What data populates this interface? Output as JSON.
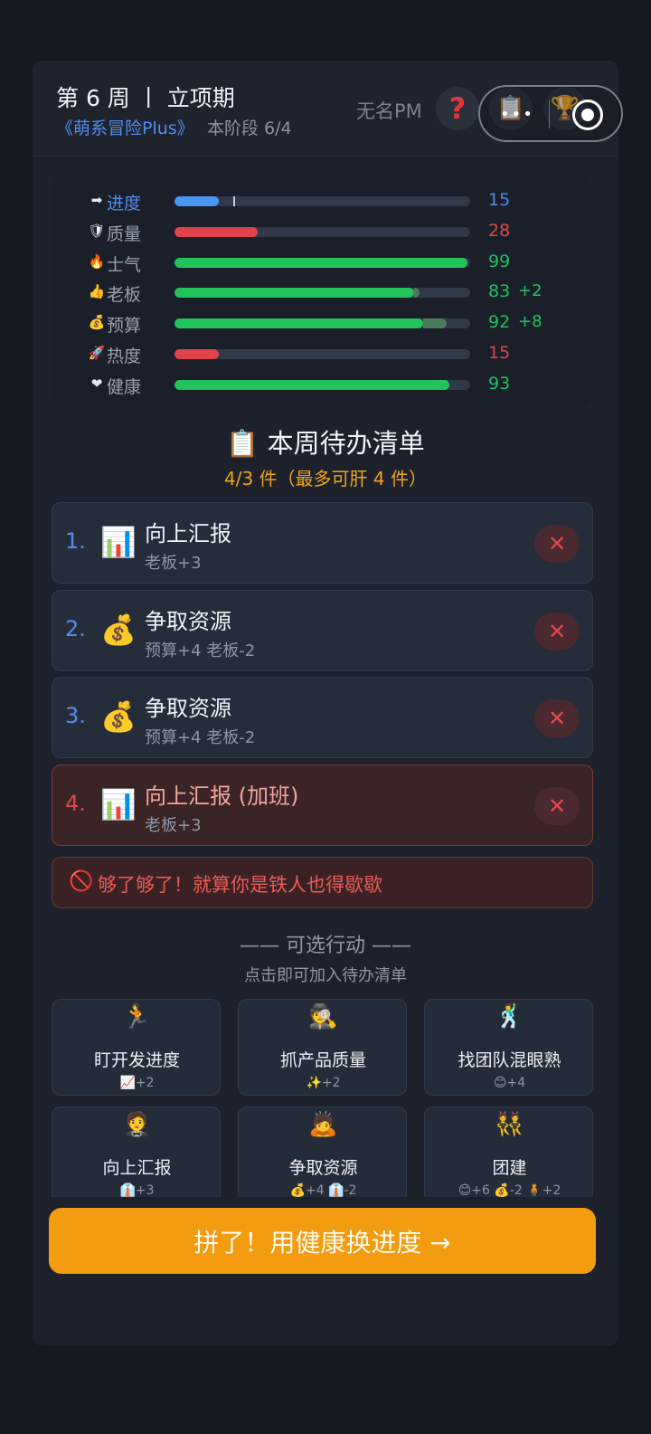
{
  "header": {
    "week_title": "第 6 周 丨 立项期",
    "game_name": "《萌系冒险Plus》",
    "stage": "本阶段 6/4",
    "player_name": "无名PM",
    "help_icon": "?",
    "log_icon": "📋",
    "trophy_icon": "🏆",
    "capsule_dots": "•••"
  },
  "stats": [
    {
      "icon": "➡",
      "label": "进度",
      "value": "15",
      "percent": 15,
      "color": "#4b95f3",
      "label_color": "#4f8ff0",
      "value_color": "#4f8ff0",
      "delta": "",
      "gain_percent": 0,
      "marker_percent": 20
    },
    {
      "icon": "🛡",
      "label": "质量",
      "value": "28",
      "percent": 28,
      "color": "#e0434a",
      "label_color": "#9aa1ae",
      "value_color": "#e0484a",
      "delta": "",
      "gain_percent": 0
    },
    {
      "icon": "🔥",
      "label": "士气",
      "value": "99",
      "percent": 99,
      "color": "#21c35a",
      "label_color": "#9aa1ae",
      "value_color": "#21c35a",
      "delta": "",
      "gain_percent": 0
    },
    {
      "icon": "👍",
      "label": "老板",
      "value": "83",
      "percent": 83,
      "color": "#21c35a",
      "label_color": "#9aa1ae",
      "value_color": "#21c35a",
      "delta": "+2",
      "gain_percent": 2
    },
    {
      "icon": "💰",
      "label": "预算",
      "value": "92",
      "percent": 92,
      "color": "#21c35a",
      "label_color": "#9aa1ae",
      "value_color": "#21c35a",
      "delta": "+8",
      "gain_percent": 8
    },
    {
      "icon": "🚀",
      "label": "热度",
      "value": "15",
      "percent": 15,
      "color": "#e0434a",
      "label_color": "#9aa1ae",
      "value_color": "#e0484a",
      "delta": "",
      "gain_percent": 0
    },
    {
      "icon": "❤",
      "label": "健康",
      "value": "93",
      "percent": 93,
      "color": "#21c35a",
      "label_color": "#9aa1ae",
      "value_color": "#21c35a",
      "delta": "",
      "gain_percent": 0
    }
  ],
  "todo": {
    "title": "📋 本周待办清单",
    "count": "4/3 件（最多可肝 4 件）",
    "remove_label": "✕",
    "items": [
      {
        "num": "1.",
        "icon": "📊",
        "name": "向上汇报",
        "effect": "老板+3",
        "overtime": false
      },
      {
        "num": "2.",
        "icon": "💰",
        "name": "争取资源",
        "effect": "预算+4 老板-2",
        "overtime": false
      },
      {
        "num": "3.",
        "icon": "💰",
        "name": "争取资源",
        "effect": "预算+4 老板-2",
        "overtime": false
      },
      {
        "num": "4.",
        "icon": "📊",
        "name": "向上汇报 (加班)",
        "effect": "老板+3",
        "overtime": true
      }
    ]
  },
  "warning": {
    "icon": "🚫",
    "text": "够了够了！就算你是铁人也得歇歇"
  },
  "optional": {
    "title": "—— 可选行动 ——",
    "hint": "点击即可加入待办清单",
    "actions": [
      {
        "icon": "🏃",
        "name": "盯开发进度",
        "effect": "📈+2"
      },
      {
        "icon": "🕵",
        "name": "抓产品质量",
        "effect": "✨+2"
      },
      {
        "icon": "🕺",
        "name": "找团队混眼熟",
        "effect": "😊+4"
      },
      {
        "icon": "🤵",
        "name": "向上汇报",
        "effect": "👔+3"
      },
      {
        "icon": "🙇",
        "name": "争取资源",
        "effect": "💰+4 👔-2"
      },
      {
        "icon": "👯",
        "name": "团建",
        "effect": "😊+6 💰-2 🧍+2"
      }
    ]
  },
  "cta": {
    "label": "拼了！用健康换进度 →"
  }
}
